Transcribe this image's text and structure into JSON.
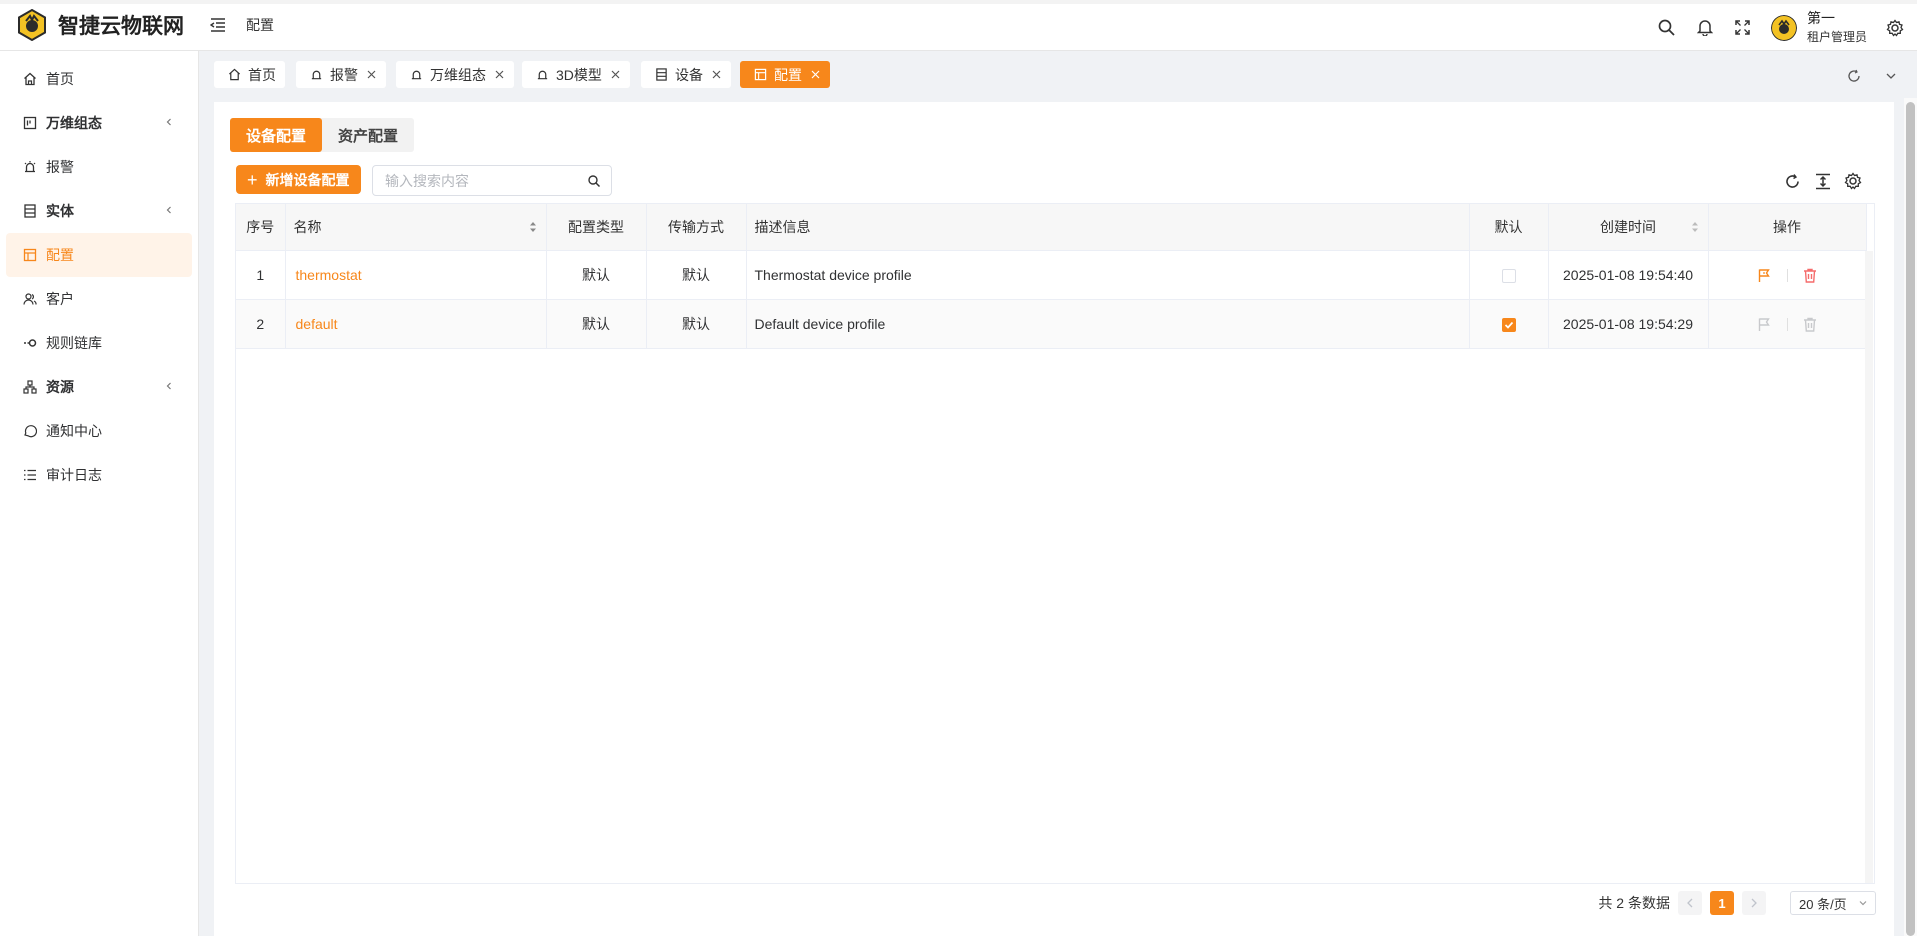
{
  "header": {
    "brand": "智捷云物联网",
    "breadcrumb": "配置",
    "user_name": "第一",
    "user_role": "租户管理员",
    "icons": [
      "search-icon",
      "bell-icon",
      "fullscreen-icon",
      "settings-icon"
    ]
  },
  "sidebar": {
    "items": [
      {
        "label": "首页",
        "icon": "home-icon"
      },
      {
        "label": "万维组态",
        "icon": "dashboard-icon",
        "expandable": true
      },
      {
        "label": "报警",
        "icon": "alarm-icon"
      },
      {
        "label": "实体",
        "icon": "entity-icon",
        "expandable": true
      },
      {
        "label": "配置",
        "icon": "config-icon",
        "active": true
      },
      {
        "label": "客户",
        "icon": "customers-icon"
      },
      {
        "label": "规则链库",
        "icon": "rule-chain-icon"
      },
      {
        "label": "资源",
        "icon": "resources-icon",
        "expandable": true
      },
      {
        "label": "通知中心",
        "icon": "notification-icon"
      },
      {
        "label": "审计日志",
        "icon": "audit-log-icon"
      }
    ]
  },
  "tabs": [
    {
      "label": "首页",
      "closable": false
    },
    {
      "label": "报警",
      "closable": true
    },
    {
      "label": "万维组态",
      "closable": true
    },
    {
      "label": "3D模型",
      "closable": true
    },
    {
      "label": "设备",
      "closable": true
    },
    {
      "label": "配置",
      "closable": true,
      "active": true
    }
  ],
  "subtabs": [
    "设备配置",
    "资产配置"
  ],
  "toolbar": {
    "add_label": "新增设备配置",
    "search_placeholder": "输入搜索内容"
  },
  "table": {
    "columns": [
      "序号",
      "名称",
      "配置类型",
      "传输方式",
      "描述信息",
      "默认",
      "创建时间",
      "操作"
    ],
    "rows": [
      {
        "index": "1",
        "name": "thermostat",
        "profile_type": "默认",
        "transport": "默认",
        "description": "Thermostat device profile",
        "is_default": false,
        "created": "2025-01-08 19:54:40"
      },
      {
        "index": "2",
        "name": "default",
        "profile_type": "默认",
        "transport": "默认",
        "description": "Default device profile",
        "is_default": true,
        "created": "2025-01-08 19:54:29"
      }
    ]
  },
  "pagination": {
    "total_text": "共 2 条数据",
    "current_page": "1",
    "page_size": "20 条/页"
  },
  "colors": {
    "accent": "#f7871b",
    "danger": "#f56c6c"
  }
}
